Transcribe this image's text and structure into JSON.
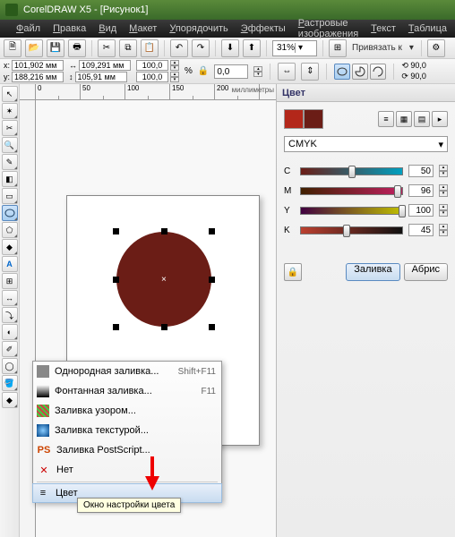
{
  "titlebar": {
    "title": "CorelDRAW X5 - [Рисунок1]"
  },
  "menu": {
    "file": "Файл",
    "edit": "Правка",
    "view": "Вид",
    "layout": "Макет",
    "arrange": "Упорядочить",
    "effects": "Эффекты",
    "bitmaps": "Растровые изображения",
    "text": "Текст",
    "table": "Таблица"
  },
  "toolbar": {
    "zoom": "31%",
    "snap_label": "Привязать к"
  },
  "property_bar": {
    "x_label": "x:",
    "y_label": "y:",
    "x": "101,902 мм",
    "y": "188,216 мм",
    "w_icon": "↔",
    "h_icon": "↕",
    "w": "109,291 мм",
    "h": "105,91 мм",
    "sx": "100,0",
    "sy": "100,0",
    "pct": "%",
    "rot": "0,0",
    "flip_h": "⟲ 90,0",
    "flip_v": "⟳ 90,0"
  },
  "ruler": {
    "t0": "0",
    "t50": "50",
    "t100": "100",
    "t150": "150",
    "t200": "200",
    "units": "миллиметры"
  },
  "dock": {
    "title": "Цвет",
    "model": "CMYK",
    "sliders": [
      {
        "label": "C",
        "value": "50",
        "pct": 50,
        "grad": "linear-gradient(90deg,#6b1d16,#00a0c0)"
      },
      {
        "label": "M",
        "value": "96",
        "pct": 96,
        "grad": "linear-gradient(90deg,#402000,#c02060)"
      },
      {
        "label": "Y",
        "value": "100",
        "pct": 100,
        "grad": "linear-gradient(90deg,#400040,#c0c000)"
      },
      {
        "label": "K",
        "value": "45",
        "pct": 45,
        "grad": "linear-gradient(90deg,#bb4030,#101010)"
      }
    ],
    "fill_btn": "Заливка",
    "outline_btn": "Абрис",
    "swatch_main": "#b3271a",
    "swatch_alt": "#6b1d16"
  },
  "context_menu": {
    "uniform": "Однородная заливка...",
    "uniform_sc": "Shift+F11",
    "fountain": "Фонтанная заливка...",
    "fountain_sc": "F11",
    "pattern": "Заливка узором...",
    "texture": "Заливка текстурой...",
    "postscript": "Заливка PostScript...",
    "none": "Нет",
    "color": "Цвет"
  },
  "tooltip": {
    "text": "Окно настройки цвета"
  }
}
